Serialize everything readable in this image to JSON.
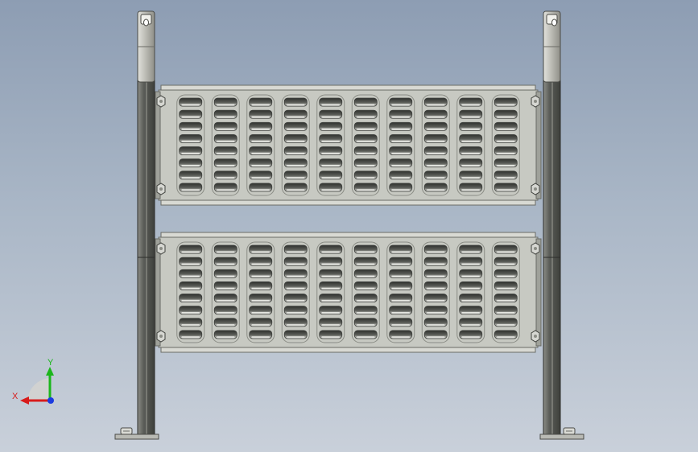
{
  "viewport": {
    "background_top": "#8d9db3",
    "background_bottom": "#c9d0da"
  },
  "model": {
    "colors": {
      "panel_fill": "#c7c9c2",
      "panel_edge": "#6a6c66",
      "slot_dark": "#3b3d3a",
      "slot_light": "#e4e5e0",
      "post_dark": "#5b5d58",
      "post_light": "#aaa9a2",
      "bolt": "#d6d7d2"
    },
    "panels": [
      {
        "name": "upper-grille-panel",
        "columns": 10,
        "rows": 8
      },
      {
        "name": "lower-grille-panel",
        "columns": 10,
        "rows": 8
      }
    ],
    "posts": [
      "left-post",
      "right-post"
    ],
    "feet": [
      "left-foot",
      "right-foot"
    ]
  },
  "triad": {
    "x_label": "X",
    "y_label": "Y",
    "x_color": "#d81b1b",
    "y_color": "#1bb61b",
    "z_color": "#1b3be0"
  }
}
